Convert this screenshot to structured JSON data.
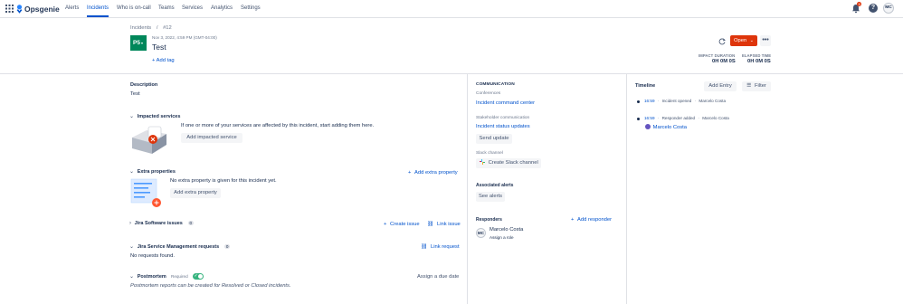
{
  "nav": {
    "brand": "Opsgenie",
    "items": [
      "Alerts",
      "Incidents",
      "Who is on-call",
      "Teams",
      "Services",
      "Analytics",
      "Settings"
    ],
    "notif_count": "5",
    "avatar_initials": "MC"
  },
  "breadcrumb": {
    "parent": "Incidents",
    "current": "#12"
  },
  "incident": {
    "badge": "P5",
    "timestamp": "Nov 3, 2022, 4:59 PM (GMT-04:00)",
    "title": "Test",
    "add_tag": "+ Add tag",
    "status": "Open",
    "impact_label": "IMPACT DURATION",
    "impact_value": "0H 0M 0S",
    "elapsed_label": "ELAPSED TIME",
    "elapsed_value": "0H 0M 0S"
  },
  "description": {
    "label": "Description",
    "text": "Test"
  },
  "impacted": {
    "title": "Impacted services",
    "text": "If one or more of your services are affected by this incident, start adding them here.",
    "button": "Add impacted service"
  },
  "extra": {
    "title": "Extra properties",
    "add_link": "Add extra property",
    "text": "No extra property is given for this incident yet.",
    "button": "Add extra property"
  },
  "jira": {
    "title": "Jira Software issues",
    "count": "0",
    "create": "Create issue",
    "link": "Link issue"
  },
  "jsm": {
    "title": "Jira Service Management requests",
    "count": "0",
    "link": "Link request",
    "empty": "No requests found."
  },
  "postmortem": {
    "title": "Postmortem",
    "required": "Required",
    "assign": "Assign a due date",
    "note": "Postmortem reports can be created for Resolved or Closed incidents."
  },
  "communication": {
    "title": "COMMUNICATION",
    "conferences": "Conferences",
    "command_center": "Incident command center",
    "stakeholder": "Stakeholder communication",
    "status_updates": "Incident status updates",
    "send_update": "Send update",
    "slack_label": "Slack channel",
    "slack_button": "Create Slack channel",
    "alerts_title": "Associated alerts",
    "see_alerts": "See alerts",
    "responders_title": "Responders",
    "add_responder": "Add responder",
    "responder_initials": "MC",
    "responder_name": "Marcelo Costa",
    "assign_role": "Assign a role"
  },
  "timeline": {
    "title": "Timeline",
    "add_entry": "Add Entry",
    "filter": "Filter",
    "entries": [
      {
        "time": "16:59",
        "sep": "·",
        "event": "Incident opened",
        "dot": "·",
        "user": "Marcelo Costa"
      },
      {
        "time": "16:59",
        "sep": "·",
        "event": "Responder added",
        "dot": "·",
        "user": "Marcelo Costa"
      }
    ],
    "added_user": "Marcelo Costa"
  },
  "colors": {
    "accent": "#0052cc",
    "open": "#de350b",
    "p5": "#00875a"
  }
}
